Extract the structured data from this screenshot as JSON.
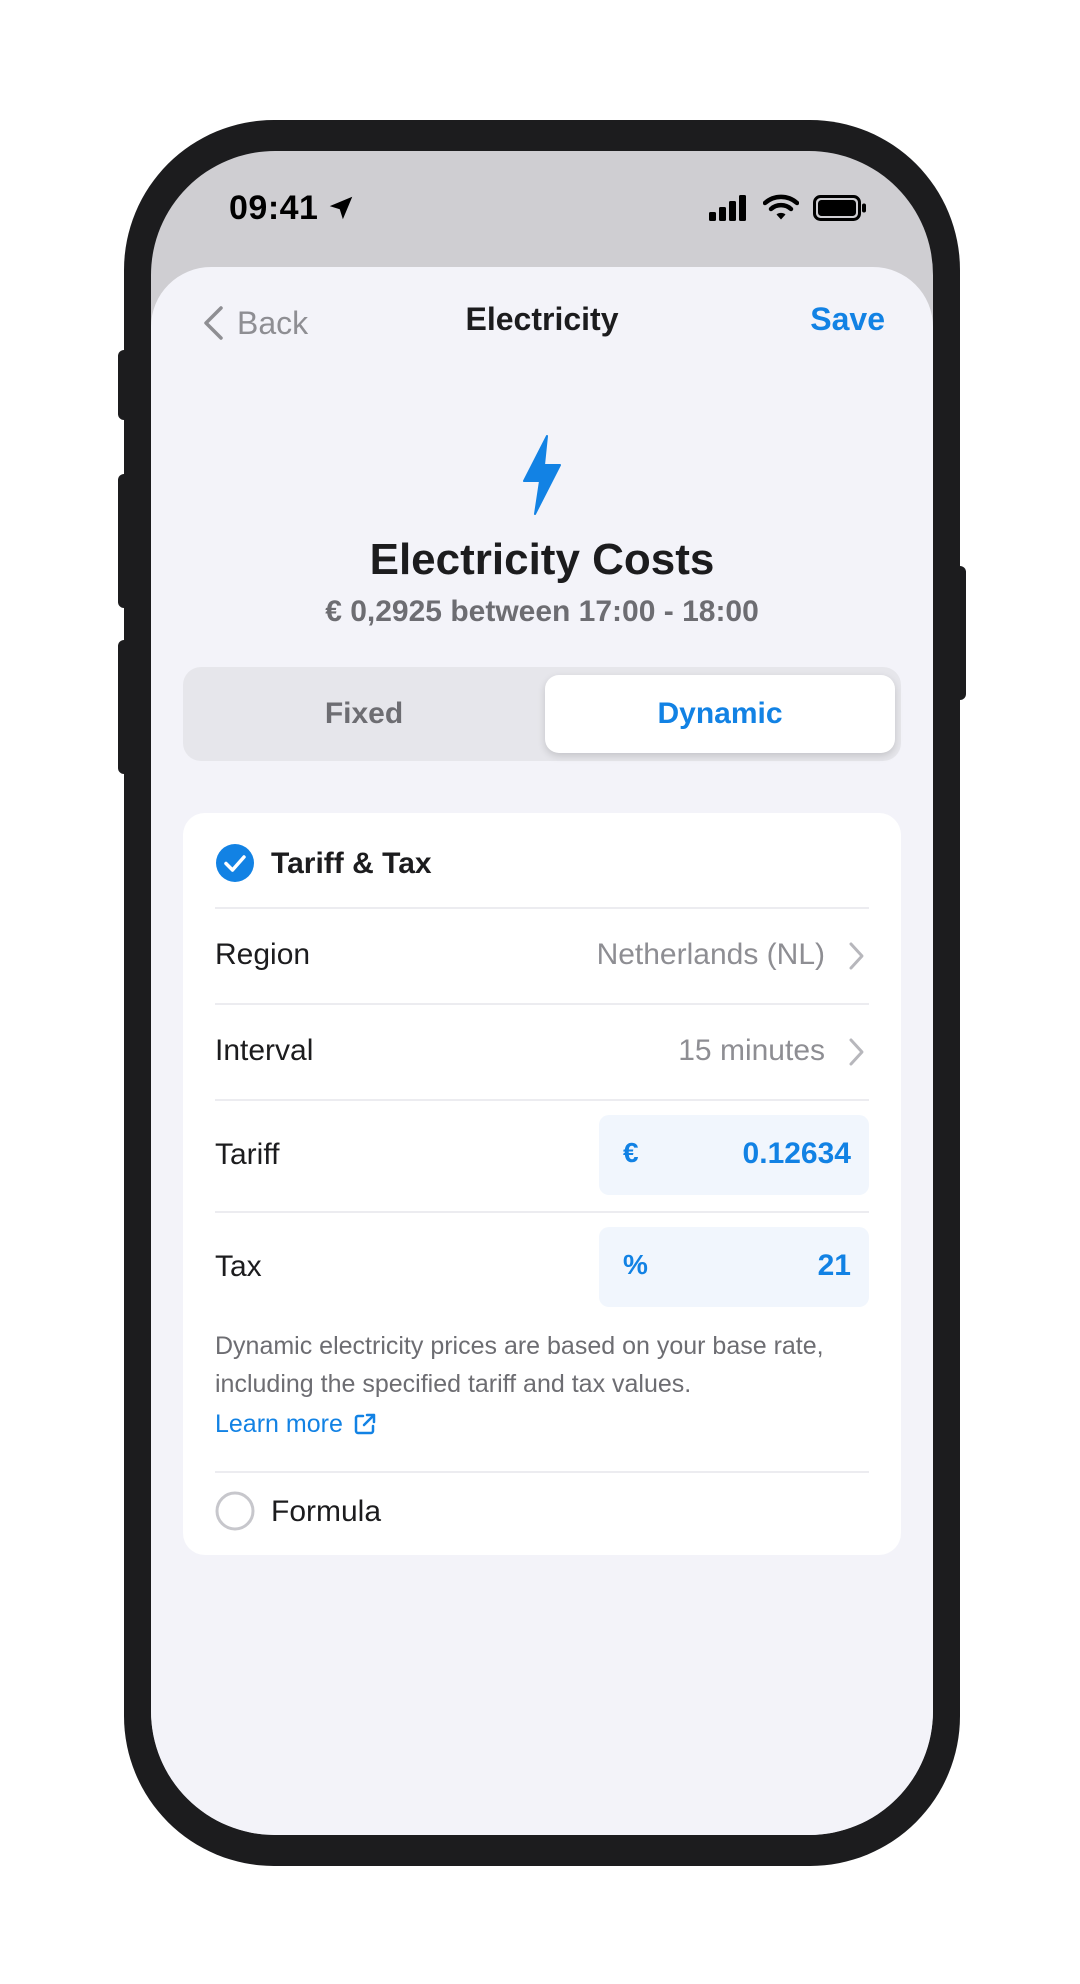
{
  "status_bar": {
    "time": "09:41"
  },
  "nav": {
    "back_label": "Back",
    "title": "Electricity",
    "save_label": "Save"
  },
  "header": {
    "title": "Electricity Costs",
    "subtitle": "€ 0,2925 between 17:00 - 18:00"
  },
  "segmented": {
    "options": [
      "Fixed",
      "Dynamic"
    ],
    "selected": "Dynamic"
  },
  "tariff_tax": {
    "label": "Tariff & Tax",
    "checked": true,
    "region": {
      "label": "Region",
      "value": "Netherlands (NL)"
    },
    "interval": {
      "label": "Interval",
      "value": "15 minutes"
    },
    "tariff": {
      "label": "Tariff",
      "prefix": "€",
      "value": "0.12634"
    },
    "tax": {
      "label": "Tax",
      "prefix": "%",
      "value": "21"
    },
    "help": "Dynamic electricity prices are based on your base rate, including the specified tariff and tax values.",
    "learn_more": "Learn more"
  },
  "formula": {
    "label": "Formula",
    "checked": false
  },
  "colors": {
    "accent": "#1282e4",
    "secondary_text": "#8e8e93",
    "background": "#f3f3f9",
    "frame": "#1c1c1e"
  }
}
